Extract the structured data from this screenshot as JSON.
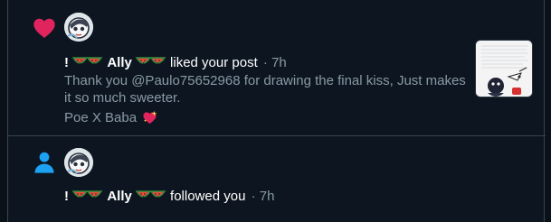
{
  "colors": {
    "like": "#e0245e",
    "follow": "#1da1f2",
    "secondary_text": "#8899a6",
    "divider": "#38444d",
    "background": "#0d1620"
  },
  "notifications": [
    {
      "type": "like",
      "type_icon": "heart-icon",
      "user": {
        "prefix": "!",
        "name": "Ally",
        "avatar_icon": "avatar-image"
      },
      "action": "liked your post",
      "time": "· 7h",
      "post": {
        "text_line1": "Thank you @Paulo75652968 for drawing the final kiss, Just makes it so much sweeter.",
        "text_line2": "Poe X Baba",
        "emoji_icon": "sparkling-heart-icon",
        "thumbnail": "post-thumbnail-image"
      }
    },
    {
      "type": "follow",
      "type_icon": "person-icon",
      "user": {
        "prefix": "!",
        "name": "Ally",
        "avatar_icon": "avatar-image"
      },
      "action": "followed you",
      "time": "· 7h"
    }
  ]
}
